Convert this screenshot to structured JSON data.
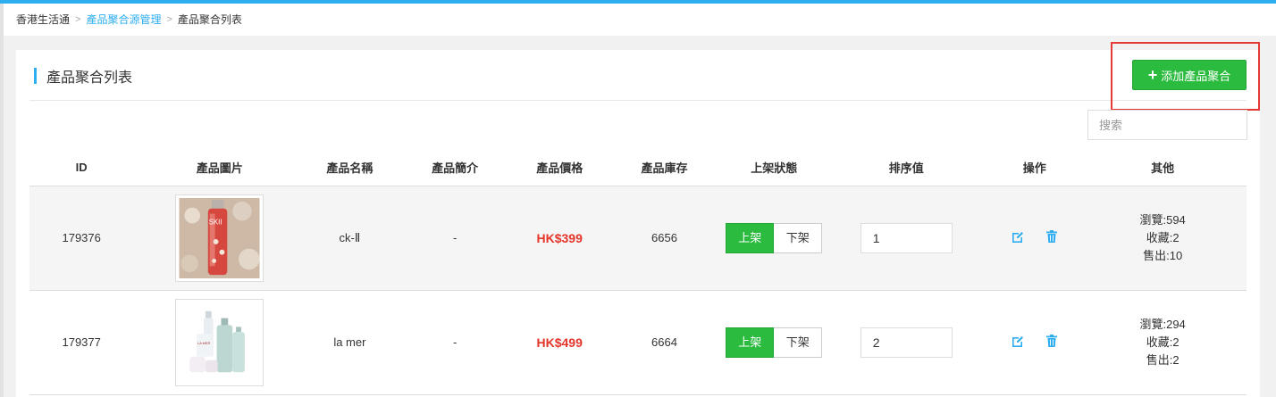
{
  "breadcrumb": {
    "home": "香港生活通",
    "parent": "產品聚合源管理",
    "current": "產品聚合列表"
  },
  "panel": {
    "title": "產品聚合列表",
    "add_button": "添加產品聚合",
    "search_placeholder": "搜索"
  },
  "table": {
    "headers": [
      "ID",
      "產品圖片",
      "產品名稱",
      "產品簡介",
      "產品價格",
      "產品庫存",
      "上架狀態",
      "排序值",
      "操作",
      "其他"
    ],
    "rows": [
      {
        "id": "179376",
        "image": "skii-bottle",
        "name": "ck-Ⅱ",
        "intro": "-",
        "price": "HK$399",
        "stock": "6656",
        "status_on": "上架",
        "status_off": "下架",
        "sort": "1",
        "views": "瀏覽:594",
        "favorites": "收藏:2",
        "sold": "售出:10"
      },
      {
        "id": "179377",
        "image": "lamer-set",
        "name": "la mer",
        "intro": "-",
        "price": "HK$499",
        "stock": "6664",
        "status_on": "上架",
        "status_off": "下架",
        "sort": "2",
        "views": "瀏覽:294",
        "favorites": "收藏:2",
        "sold": "售出:2"
      }
    ]
  },
  "colors": {
    "accent": "#2eaef0",
    "primary_button": "#2bbb3f",
    "price": "#e5352a",
    "highlight_box": "#e53935"
  },
  "icons": {
    "edit": "edit-icon",
    "delete": "trash-icon",
    "add": "plus-icon"
  }
}
